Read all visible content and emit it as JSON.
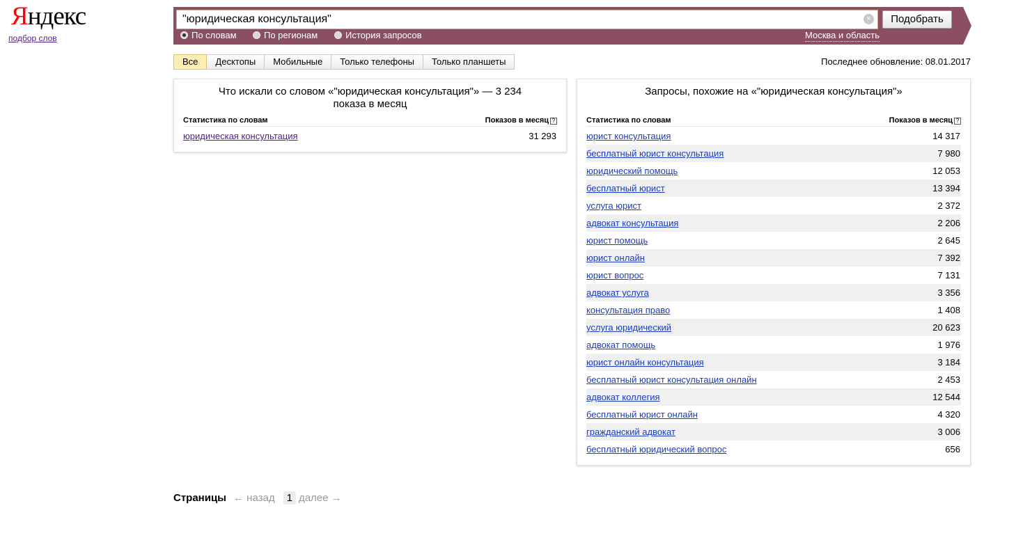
{
  "logo": {
    "first_letter": "Я",
    "rest": "ндекс",
    "sub_link": "подбор слов"
  },
  "search": {
    "value": "\"юридическая консультация\"",
    "clear_icon": "×",
    "button": "Подобрать"
  },
  "radios": [
    {
      "label": "По словам",
      "checked": true
    },
    {
      "label": "По регионам",
      "checked": false
    },
    {
      "label": "История запросов",
      "checked": false
    }
  ],
  "region": "Москва и область",
  "tabs": [
    "Все",
    "Десктопы",
    "Мобильные",
    "Только телефоны",
    "Только планшеты"
  ],
  "updated": "Последнее обновление: 08.01.2017",
  "left_panel": {
    "title": "Что искали со словом «\"юридическая консультация\"» — 3 234 показа в месяц",
    "col_words": "Статистика по словам",
    "col_shows": "Показов в месяц",
    "help_icon": "?",
    "rows": [
      {
        "phrase": "юридическая консультация",
        "count": "31 293"
      }
    ]
  },
  "right_panel": {
    "title": "Запросы, похожие на «\"юридическая консультация\"»",
    "col_words": "Статистика по словам",
    "col_shows": "Показов в месяц",
    "help_icon": "?",
    "rows": [
      {
        "phrase": "юрист консультация",
        "count": "14 317"
      },
      {
        "phrase": "бесплатный юрист консультация",
        "count": "7 980"
      },
      {
        "phrase": "юридический помощь",
        "count": "12 053"
      },
      {
        "phrase": "бесплатный юрист",
        "count": "13 394"
      },
      {
        "phrase": "услуга юрист",
        "count": "2 372"
      },
      {
        "phrase": "адвокат консультация",
        "count": "2 206"
      },
      {
        "phrase": "юрист помощь",
        "count": "2 645"
      },
      {
        "phrase": "юрист онлайн",
        "count": "7 392"
      },
      {
        "phrase": "юрист вопрос",
        "count": "7 131"
      },
      {
        "phrase": "адвокат услуга",
        "count": "3 356"
      },
      {
        "phrase": "консультация право",
        "count": "1 408"
      },
      {
        "phrase": "услуга юридический",
        "count": "20 623"
      },
      {
        "phrase": "адвокат помощь",
        "count": "1 976"
      },
      {
        "phrase": "юрист онлайн консультация",
        "count": "3 184"
      },
      {
        "phrase": "бесплатный юрист консультация онлайн",
        "count": "2 453"
      },
      {
        "phrase": "адвокат коллегия",
        "count": "12 544"
      },
      {
        "phrase": "бесплатный юрист онлайн",
        "count": "4 320"
      },
      {
        "phrase": "гражданский адвокат",
        "count": "3 006"
      },
      {
        "phrase": "бесплатный юридический вопрос",
        "count": "656"
      }
    ]
  },
  "pager": {
    "label": "Страницы",
    "prev": "← назад",
    "current": "1",
    "next": "далее →"
  }
}
